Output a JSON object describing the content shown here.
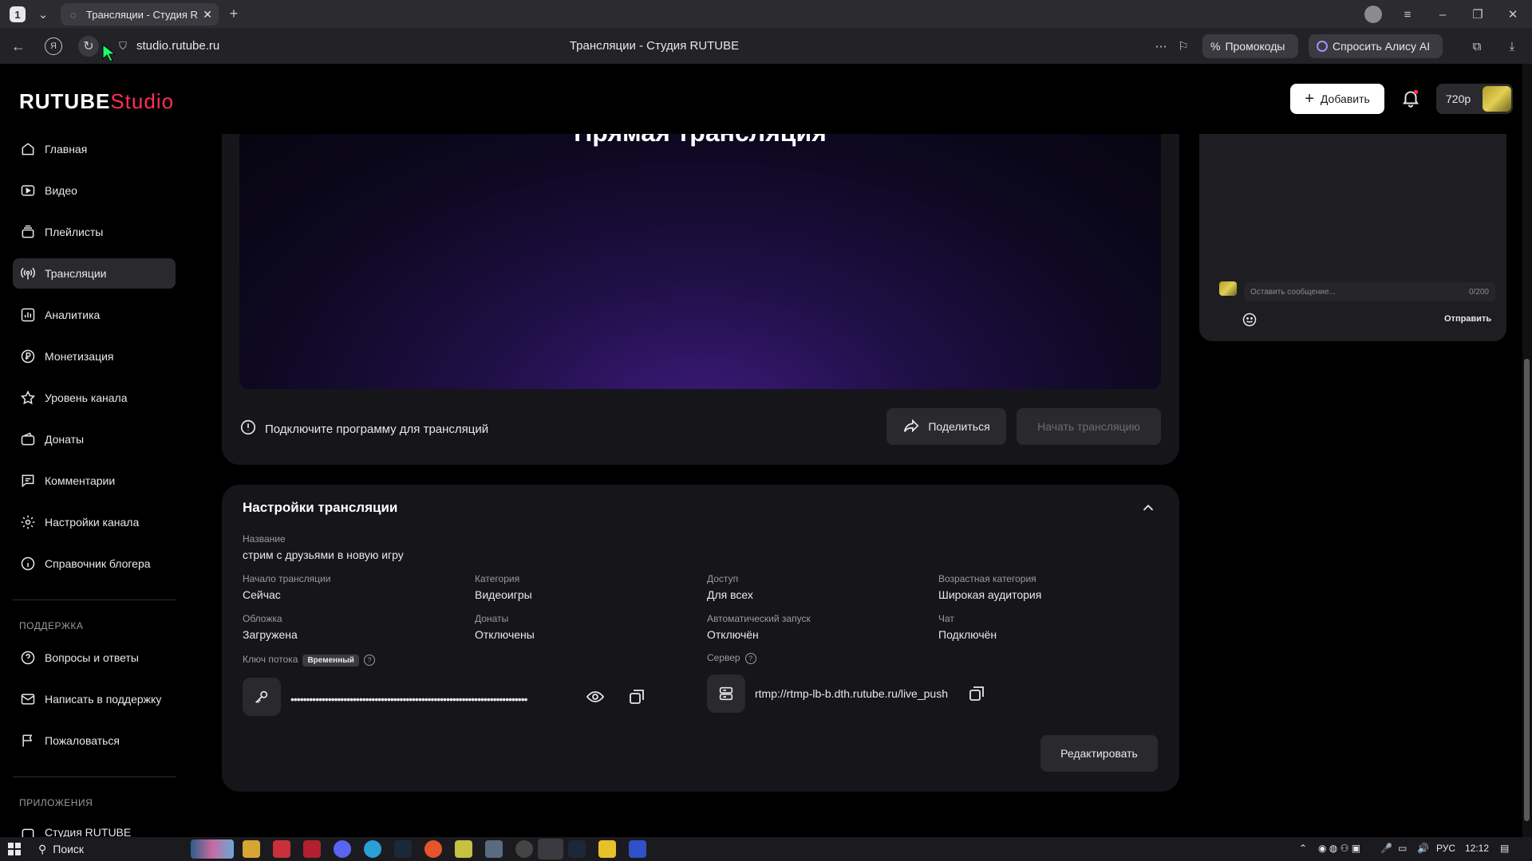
{
  "browser": {
    "tab_count": "1",
    "tab_title": "Трансляции - Студия R",
    "url": "studio.rutube.ru",
    "page_title": "Трансляции - Студия RUTUBE",
    "promo_label": "Промокоды",
    "alice_label": "Спросить Алису AI"
  },
  "header": {
    "logo_main": "RUTUBE",
    "logo_studio": "Studio",
    "add_label": "Добавить",
    "quality": "720p"
  },
  "sidebar": {
    "items": [
      {
        "label": "Главная"
      },
      {
        "label": "Видео"
      },
      {
        "label": "Плейлисты"
      },
      {
        "label": "Трансляции"
      },
      {
        "label": "Аналитика"
      },
      {
        "label": "Монетизация"
      },
      {
        "label": "Уровень канала"
      },
      {
        "label": "Донаты"
      },
      {
        "label": "Комментарии"
      },
      {
        "label": "Настройки канала"
      },
      {
        "label": "Справочник блогера"
      }
    ],
    "support_title": "ПОДДЕРЖКА",
    "support_items": [
      {
        "label": "Вопросы и ответы"
      },
      {
        "label": "Написать в поддержку"
      },
      {
        "label": "Пожаловаться"
      }
    ],
    "apps_title": "ПРИЛОЖЕНИЯ",
    "apps_items": [
      {
        "label": "Студия RUTUBE"
      }
    ]
  },
  "player": {
    "title": "Прямая трансляция",
    "connect_text": "Подключите программу для трансляций",
    "share_label": "Поделиться",
    "start_label": "Начать трансляцию"
  },
  "chat": {
    "placeholder": "Оставить сообщение...",
    "counter": "0/200",
    "send_label": "Отправить"
  },
  "settings": {
    "title": "Настройки трансляции",
    "name_label": "Название",
    "name_value": "стрим с друзьями в новую игру",
    "start_label": "Начало трансляции",
    "start_value": "Сейчас",
    "category_label": "Категория",
    "category_value": "Видеоигры",
    "access_label": "Доступ",
    "access_value": "Для всех",
    "age_label": "Возрастная категория",
    "age_value": "Широкая аудитория",
    "cover_label": "Обложка",
    "cover_value": "Загружена",
    "donations_label": "Донаты",
    "donations_value": "Отключены",
    "autostart_label": "Автоматический запуск",
    "autostart_value": "Отключён",
    "chat_label": "Чат",
    "chat_value": "Подключён",
    "key_label": "Ключ потока",
    "key_badge": "Временный",
    "key_masked": "••••••••••••••••••••••••••••••••••••••••••••••••••••••••••••••••••••••••••••",
    "server_label": "Сервер",
    "server_value": "rtmp://rtmp-lb-b.dth.rutube.ru/live_push",
    "edit_label": "Редактировать"
  },
  "taskbar": {
    "search_label": "Поиск",
    "lang": "РУС",
    "time": "12:12"
  }
}
